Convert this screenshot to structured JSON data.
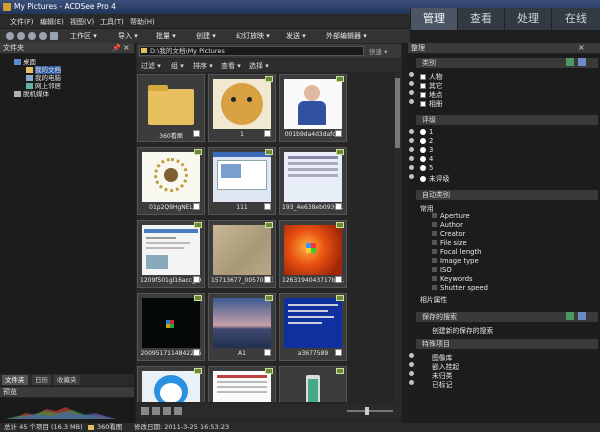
{
  "window": {
    "title": "My Pictures - ACDSee Pro 4"
  },
  "menu": [
    "文件(F)",
    "编辑(E)",
    "视图(V)",
    "工具(T)",
    "帮助(H)"
  ],
  "modes": [
    {
      "label": "管理",
      "active": true
    },
    {
      "label": "查看",
      "active": false
    },
    {
      "label": "处理",
      "active": false
    },
    {
      "label": "在线",
      "active": false
    }
  ],
  "toolbar": [
    "工作区 ▾",
    "导入 ▾",
    "批量 ▾",
    "创建 ▾",
    "幻灯放映 ▾",
    "发送 ▾",
    "外部编辑器 ▾"
  ],
  "folders_panel": {
    "title": "文件夹",
    "tree": [
      {
        "label": "桌面",
        "level": 0
      },
      {
        "label": "我的文档",
        "level": 1,
        "selected": true
      },
      {
        "label": "我的电脑",
        "level": 1
      },
      {
        "label": "网上邻居",
        "level": 1
      },
      {
        "label": "脱机媒体",
        "level": 0
      }
    ]
  },
  "left_tabs": [
    {
      "label": "文件夹",
      "active": true
    },
    {
      "label": "日历",
      "active": false
    },
    {
      "label": "收藏夹",
      "active": false
    }
  ],
  "preview_panel": {
    "title": "预览"
  },
  "path_bar": {
    "path": "D:\\我的文档\\My Pictures",
    "extra": "快速 ▾"
  },
  "filter_bar": [
    "过滤 ▾",
    "组 ▾",
    "排序 ▾",
    "查看 ▾",
    "选择 ▾"
  ],
  "thumbnails": [
    {
      "caption": "360看图",
      "kind": "folder"
    },
    {
      "caption": "1",
      "kind": "doge"
    },
    {
      "caption": "001b9da4d3dafc...",
      "kind": "person"
    },
    {
      "caption": "01p2Q9HgNEL",
      "kind": "sunflower"
    },
    {
      "caption": "111",
      "kind": "screen"
    },
    {
      "caption": "193_4e638eb0936c...",
      "kind": "form"
    },
    {
      "caption": "1209f501gl16acc_f9...",
      "kind": "webpage"
    },
    {
      "caption": "15713677_00570693...",
      "kind": "texture"
    },
    {
      "caption": "1263194043717b4c...",
      "kind": "win7"
    },
    {
      "caption": "2009517114842235",
      "kind": "dark"
    },
    {
      "caption": "A1",
      "kind": "sunset"
    },
    {
      "caption": "a3677589",
      "kind": "bluescreen"
    },
    {
      "caption": "",
      "kind": "doraemon"
    },
    {
      "caption": "",
      "kind": "table"
    },
    {
      "caption": "",
      "kind": "phone"
    }
  ],
  "properties_panel": {
    "title": "整理",
    "sections": {
      "categories": {
        "title": "类别",
        "items": [
          "人物",
          "其它",
          "地点",
          "相册"
        ]
      },
      "ratings": {
        "title": "评级",
        "items": [
          "1",
          "2",
          "3",
          "4",
          "5",
          "未评级"
        ]
      },
      "auto": {
        "title": "自动类别",
        "group": "常用",
        "items": [
          "Aperture",
          "Author",
          "Creator",
          "File size",
          "Focal length",
          "Image type",
          "ISO",
          "Keywords",
          "Shutter speed"
        ],
        "group2": "相片属性"
      },
      "saved": {
        "title": "保存的搜索",
        "action": "创建新的保存的搜索"
      },
      "special": {
        "title": "特殊项目",
        "items": [
          "图像库",
          "嵌入挂起",
          "未归类",
          "已标记"
        ]
      }
    }
  },
  "statusbar": {
    "total": "总计 45 个项目 (16.3 MB)",
    "folder": "360看图",
    "modified": "修改日期: 2011-3-25 16:53:23"
  },
  "icons": [
    "app-icon",
    "back-icon",
    "forward-icon",
    "folder-icon",
    "computer-icon",
    "network-icon",
    "pin-icon",
    "close-icon",
    "sync-icon"
  ]
}
